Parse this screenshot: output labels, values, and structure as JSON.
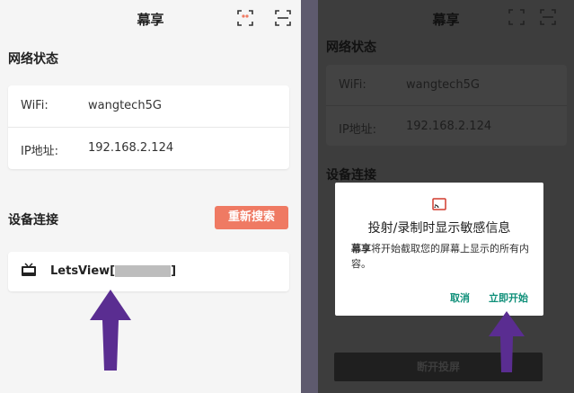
{
  "left": {
    "title": "幕享",
    "network_section": "网络状态",
    "wifi_label": "WiFi:",
    "wifi_value": "wangtech5G",
    "ip_label": "IP地址:",
    "ip_value": "192.168.2.124",
    "device_section": "设备连接",
    "research_label": "重新搜索",
    "device_name_prefix": "LetsView[",
    "device_name_suffix": "]"
  },
  "right": {
    "title": "幕享",
    "network_section": "网络状态",
    "wifi_label": "WiFi:",
    "wifi_value": "wangtech5G",
    "ip_label": "IP地址:",
    "ip_value": "192.168.2.124",
    "device_section": "设备连接",
    "disconnect_label": "断开投屏",
    "dialog": {
      "title": "投射/录制时显示敏感信息",
      "app_name": "幕享",
      "body": "将开始截取您的屏幕上显示的所有内容。",
      "cancel_label": "取消",
      "start_label": "立即开始"
    }
  },
  "colors": {
    "accent": "#ef7a63",
    "dialog_button": "#10907a",
    "arrow": "#5a2d91"
  },
  "icons": [
    "cast-icon",
    "scan-icon",
    "tv-icon",
    "up-arrow"
  ]
}
